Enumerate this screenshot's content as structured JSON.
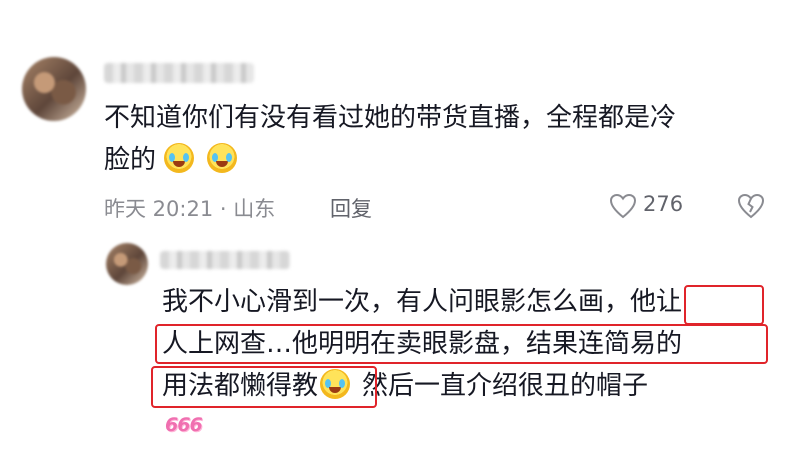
{
  "comment": {
    "text_line1": "不知道你们有没有看过她的带货直播，全程都是冷",
    "text_line2": "脸的",
    "emojis": [
      "crying-laughing-emoji",
      "crying-laughing-emoji"
    ],
    "time_location": "昨天 20:21 · 山东",
    "reply_label": "回复",
    "like_count": "276"
  },
  "reply": {
    "line1_a": "我不小心滑到一次，有人问眼影怎么画，",
    "line1_b": "他让",
    "line2": "人上网查…他明明在卖眼影盘，结果连简易的",
    "line3_a": "用法都懒得教",
    "line3_b": "然后一直介绍很丑的帽子",
    "emoji": "crying-laughing-emoji",
    "sticker": "666"
  },
  "colors": {
    "highlight_box": "#e0242a",
    "meta_text": "#8a8b91",
    "body_text": "#161823"
  }
}
